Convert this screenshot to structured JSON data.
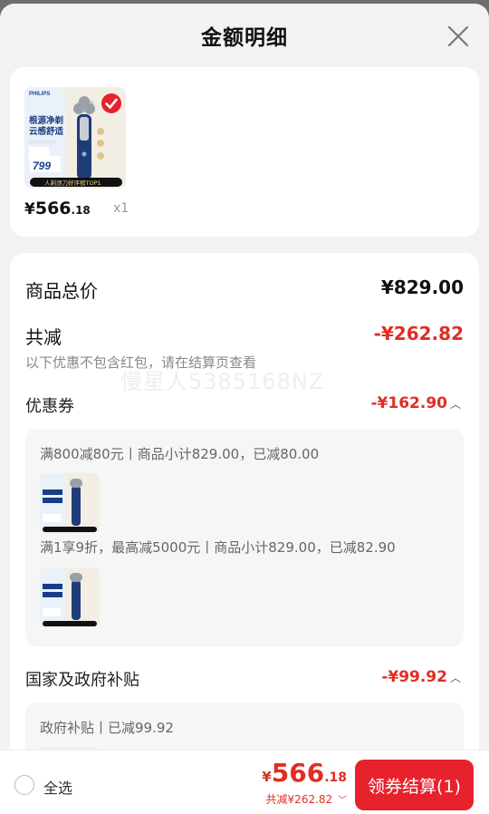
{
  "header": {
    "title": "金额明细"
  },
  "product": {
    "image": {
      "brand": "PHILIPS",
      "headline_1": "根源净剃",
      "headline_2": "云感舒适",
      "price": "799",
      "banner": "人剃须刀好评榜TOP1"
    },
    "price_yen": "¥",
    "price_int": "566",
    "price_dec": ".18",
    "qty": "x1"
  },
  "summary": {
    "total_label": "商品总价",
    "total_value": "¥829.00",
    "discount_label": "共减",
    "discount_value": "-¥262.82",
    "note": "以下优惠不包含红包，请在结算页查看",
    "watermark": "慢星人5385168NZ"
  },
  "coupons": {
    "label": "优惠券",
    "value": "-¥162.90",
    "rules": [
      "满800减80元丨商品小计829.00，已减80.00",
      "满1享9折，最高减5000元丨商品小计829.00，已减82.90"
    ]
  },
  "subsidy": {
    "label": "国家及政府补贴",
    "value": "-¥99.92",
    "rule": "政府补贴丨已减99.92"
  },
  "bottom_bar": {
    "select_all": "全选",
    "total_yen": "¥",
    "total_int": "566",
    "total_dec": ".18",
    "total_discount": "共减¥262.82",
    "checkout_label": "领券结算(1)"
  },
  "colors": {
    "accent": "#e02e24",
    "checkout_bg": "#e8222d",
    "check_badge": "#e8222d"
  },
  "icons": [
    "close-icon",
    "check-badge-icon",
    "chevron-up-icon",
    "chevron-down-icon",
    "radio-icon"
  ]
}
